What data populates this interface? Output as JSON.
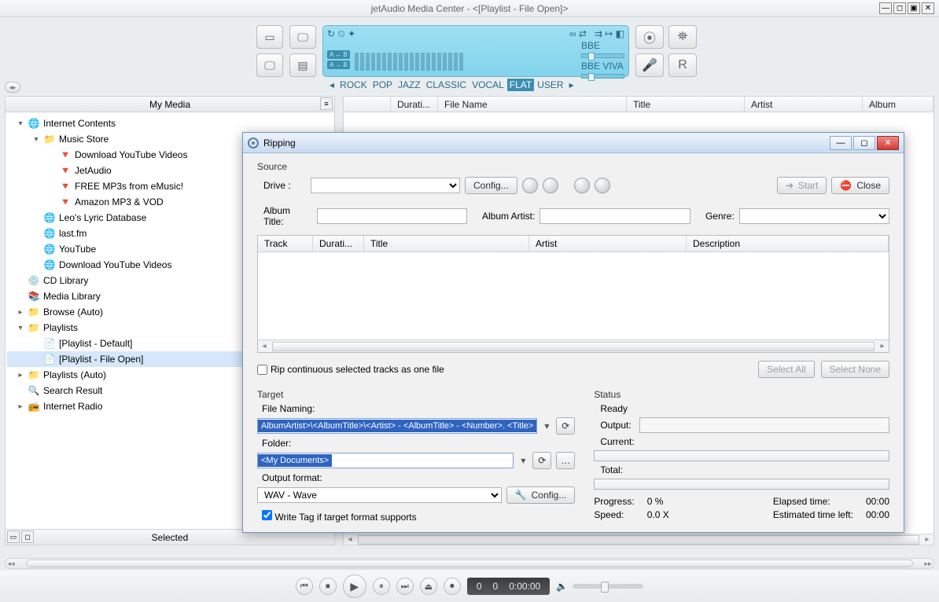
{
  "window": {
    "title": "jetAudio Media Center - <[Playlist - File Open]>"
  },
  "lcd": {
    "badge_a": "A ↔ B",
    "badge_b": "A → B",
    "presets": [
      "ROCK",
      "POP",
      "JAZZ",
      "CLASSIC",
      "VOCAL",
      "FLAT",
      "USER"
    ],
    "preset_active": "FLAT",
    "bbe1": "BBE",
    "bbe2": "BBE VIVA"
  },
  "sidebar": {
    "header": "My Media",
    "selected_header": "Selected",
    "items": [
      {
        "level": 1,
        "exp": "▾",
        "icon": "🌐",
        "label": "Internet Contents"
      },
      {
        "level": 2,
        "exp": "▾",
        "icon": "📁",
        "label": "Music Store"
      },
      {
        "level": 3,
        "exp": "",
        "icon": "🔻",
        "label": "Download YouTube Videos"
      },
      {
        "level": 3,
        "exp": "",
        "icon": "🔻",
        "label": "JetAudio"
      },
      {
        "level": 3,
        "exp": "",
        "icon": "🔻",
        "label": "FREE MP3s from eMusic!"
      },
      {
        "level": 3,
        "exp": "",
        "icon": "🔻",
        "label": "Amazon MP3 & VOD"
      },
      {
        "level": 2,
        "exp": "",
        "icon": "🌐",
        "label": "Leo's Lyric Database"
      },
      {
        "level": 2,
        "exp": "",
        "icon": "🌐",
        "label": "last.fm"
      },
      {
        "level": 2,
        "exp": "",
        "icon": "🌐",
        "label": "YouTube"
      },
      {
        "level": 2,
        "exp": "",
        "icon": "🌐",
        "label": "Download YouTube Videos"
      },
      {
        "level": 1,
        "exp": "",
        "icon": "💿",
        "label": "CD Library"
      },
      {
        "level": 1,
        "exp": "",
        "icon": "📚",
        "label": "Media Library"
      },
      {
        "level": 1,
        "exp": "▸",
        "icon": "📁",
        "label": "Browse (Auto)"
      },
      {
        "level": 1,
        "exp": "▾",
        "icon": "📁",
        "label": "Playlists"
      },
      {
        "level": 2,
        "exp": "",
        "icon": "📄",
        "label": "[Playlist - Default]"
      },
      {
        "level": 2,
        "exp": "",
        "icon": "📄",
        "label": "[Playlist - File Open]",
        "selected": true
      },
      {
        "level": 1,
        "exp": "▸",
        "icon": "📁",
        "label": "Playlists (Auto)"
      },
      {
        "level": 1,
        "exp": "",
        "icon": "🔍",
        "label": "Search Result"
      },
      {
        "level": 1,
        "exp": "▸",
        "icon": "📻",
        "label": "Internet Radio"
      }
    ]
  },
  "list_columns": {
    "c1": "Durati...",
    "c2": "File Name",
    "c3": "Title",
    "c4": "Artist",
    "c5": "Album"
  },
  "dialog": {
    "title": "Ripping",
    "source_label": "Source",
    "drive_label": "Drive :",
    "config_btn": "Config...",
    "start_btn": "Start",
    "close_btn": "Close",
    "album_title_label": "Album Title:",
    "album_artist_label": "Album Artist:",
    "genre_label": "Genre:",
    "track_cols": {
      "track": "Track",
      "dur": "Durati...",
      "title": "Title",
      "artist": "Artist",
      "desc": "Description"
    },
    "rip_cont": "Rip continuous selected tracks as one file",
    "select_all": "Select All",
    "select_none": "Select None",
    "target_label": "Target",
    "file_naming_label": "File Naming:",
    "file_naming_value": "AlbumArtist>\\<AlbumTitle>\\<Artist> - <AlbumTitle> - <Number>. <Title>",
    "folder_label": "Folder:",
    "folder_value": "<My Documents>",
    "output_format_label": "Output format:",
    "output_format_value": "WAV - Wave",
    "config2_btn": "Config...",
    "write_tag": "Write Tag if target format supports",
    "status_label": "Status",
    "ready": "Ready",
    "output": "Output:",
    "current": "Current:",
    "total": "Total:",
    "progress_label": "Progress:",
    "progress_val": "0 %",
    "speed_label": "Speed:",
    "speed_val": "0.0 X",
    "elapsed_label": "Elapsed time:",
    "elapsed_val": "00:00",
    "est_label": "Estimated time left:",
    "est_val": "00:00"
  },
  "player": {
    "t1": "0",
    "t2": "0",
    "t3": "0:00:00",
    "vol_icon": "🔈"
  }
}
